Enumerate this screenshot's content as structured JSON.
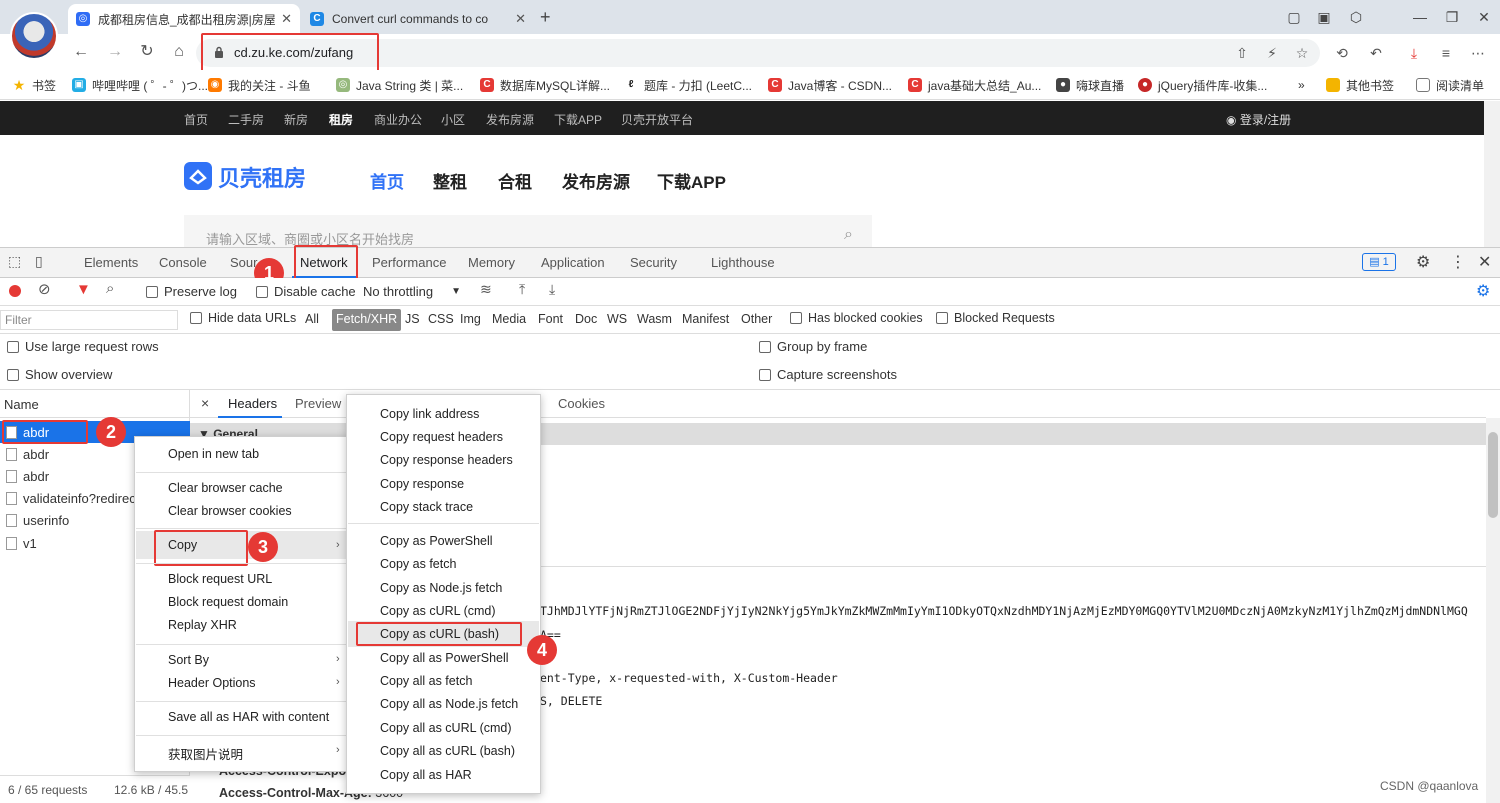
{
  "browser": {
    "tabs": [
      {
        "title": "成都租房信息_成都出租房源|房屋",
        "favicon_color": "#2f6cf5",
        "active": true
      },
      {
        "title": "Convert curl commands to co",
        "favicon_color": "#1e88e5",
        "active": false
      }
    ],
    "new_tab_symbol": "+",
    "url": "cd.zu.ke.com/zufang",
    "bookmarks": [
      {
        "label": "书签",
        "icon_color": "#f4b400"
      },
      {
        "label": "哔哩哔哩 ( ゜- ゜)つ...",
        "icon_color": "#23ade5"
      },
      {
        "label": "我的关注 - 斗鱼",
        "icon_color": "#ff7a00"
      },
      {
        "label": "Java String 类 | 菜...",
        "icon_color": "#96b97d"
      },
      {
        "label": "数据库MySQL详解...",
        "icon_color": "#e53935"
      },
      {
        "label": "题库 - 力扣 (LeetC...",
        "icon_color": "#222222"
      },
      {
        "label": "Java博客 - CSDN...",
        "icon_color": "#e53935"
      },
      {
        "label": "java基础大总结_Au...",
        "icon_color": "#e53935"
      },
      {
        "label": "嗨球直播",
        "icon_color": "#444444"
      },
      {
        "label": "jQuery插件库-收集...",
        "icon_color": "#c62828"
      }
    ],
    "bookmarks_more": "»",
    "other_bookmarks": "其他书签",
    "reading_list": "阅读清单"
  },
  "site": {
    "top_nav": [
      "首页",
      "二手房",
      "新房",
      "租房",
      "商业办公",
      "小区",
      "发布房源",
      "下载APP",
      "贝壳开放平台"
    ],
    "top_nav_active": "租房",
    "login": "登录/注册",
    "logo": "贝壳租房",
    "main_nav": [
      "首页",
      "整租",
      "合租",
      "发布房源",
      "下载APP"
    ],
    "search_placeholder": "请输入区域、商圈或小区名开始找房"
  },
  "devtools": {
    "panel_tabs": [
      "Elements",
      "Console",
      "Sources",
      "Network",
      "Performance",
      "Memory",
      "Application",
      "Security",
      "Lighthouse"
    ],
    "sources_visible": "Sour",
    "active_tab": "Network",
    "issues_count": "1",
    "controls": {
      "preserve_log": "Preserve log",
      "disable_cache": "Disable cache",
      "throttling": "No throttling"
    },
    "filter_placeholder": "Filter",
    "filter_types": {
      "hide_data_urls": "Hide data URLs",
      "types": [
        "All",
        "Fetch/XHR",
        "JS",
        "CSS",
        "Img",
        "Media",
        "Font",
        "Doc",
        "WS",
        "Wasm",
        "Manifest",
        "Other"
      ],
      "active": "Fetch/XHR",
      "has_blocked_cookies": "Has blocked cookies",
      "blocked_requests": "Blocked Requests"
    },
    "options": {
      "large_rows": "Use large request rows",
      "show_overview": "Show overview",
      "group_by_frame": "Group by frame",
      "capture_screenshots": "Capture screenshots"
    },
    "list_header": "Name",
    "requests": [
      "abdr",
      "abdr",
      "abdr",
      "validateinfo?redirect",
      "userinfo",
      "v1"
    ],
    "selected_request": 0,
    "status": {
      "requests": "6 / 65 requests",
      "size": "12.6 kB / 45.5"
    },
    "detail_tabs": [
      "Headers",
      "Preview",
      "Cookies"
    ],
    "detail_close": "×",
    "general_label": "▼ General",
    "detail_lines": [
      "TJhMDJlYTFjNjRmZTJlOGE2NDFjYjIyN2NkYjg5YmJkYmZkMWZmMmIyYmI1ODkyOTQxNzdhMDY1NjAzMjEzMDY0MGQ0YTVlM2U0MDczNjA0MzkyNzM1YjlhZmQzMjdmNDNlMGQ",
      "A==",
      "ent-Type, x-requested-with, X-Custom-Header",
      "S, DELETE"
    ],
    "header_keys": [
      {
        "key": "Access-Control-Expo",
        "value": ""
      },
      {
        "key": "Access-Control-Max-Age:",
        "value": "3600"
      }
    ]
  },
  "context_menu": {
    "items": [
      {
        "label": "Open in new tab",
        "group": 1
      },
      {
        "label": "Clear browser cache",
        "group": 2
      },
      {
        "label": "Clear browser cookies",
        "group": 2
      },
      {
        "label": "Copy",
        "group": 3,
        "submenu": true
      },
      {
        "label": "Block request URL",
        "group": 4
      },
      {
        "label": "Block request domain",
        "group": 4
      },
      {
        "label": "Replay XHR",
        "group": 4
      },
      {
        "label": "Sort By",
        "group": 5,
        "submenu": true
      },
      {
        "label": "Header Options",
        "group": 5,
        "submenu": true
      },
      {
        "label": "Save all as HAR with content",
        "group": 6
      },
      {
        "label": "获取图片说明",
        "group": 7,
        "submenu": true
      }
    ]
  },
  "copy_submenu": {
    "items": [
      "Copy link address",
      "Copy request headers",
      "Copy response headers",
      "Copy response",
      "Copy stack trace",
      "Copy as PowerShell",
      "Copy as fetch",
      "Copy as Node.js fetch",
      "Copy as cURL (cmd)",
      "Copy as cURL (bash)",
      "Copy all as PowerShell",
      "Copy all as fetch",
      "Copy all as Node.js fetch",
      "Copy all as cURL (cmd)",
      "Copy all as cURL (bash)",
      "Copy all as HAR"
    ],
    "highlighted": "Copy as cURL (bash)"
  },
  "annotations": {
    "steps": [
      "1",
      "2",
      "3",
      "4"
    ],
    "color": "#e53935"
  },
  "watermark": "CSDN @qaanlova",
  "colors": {
    "accent": "#1a73e8",
    "brand": "#3072f6",
    "annotation": "#e53935",
    "record": "#e53935"
  }
}
